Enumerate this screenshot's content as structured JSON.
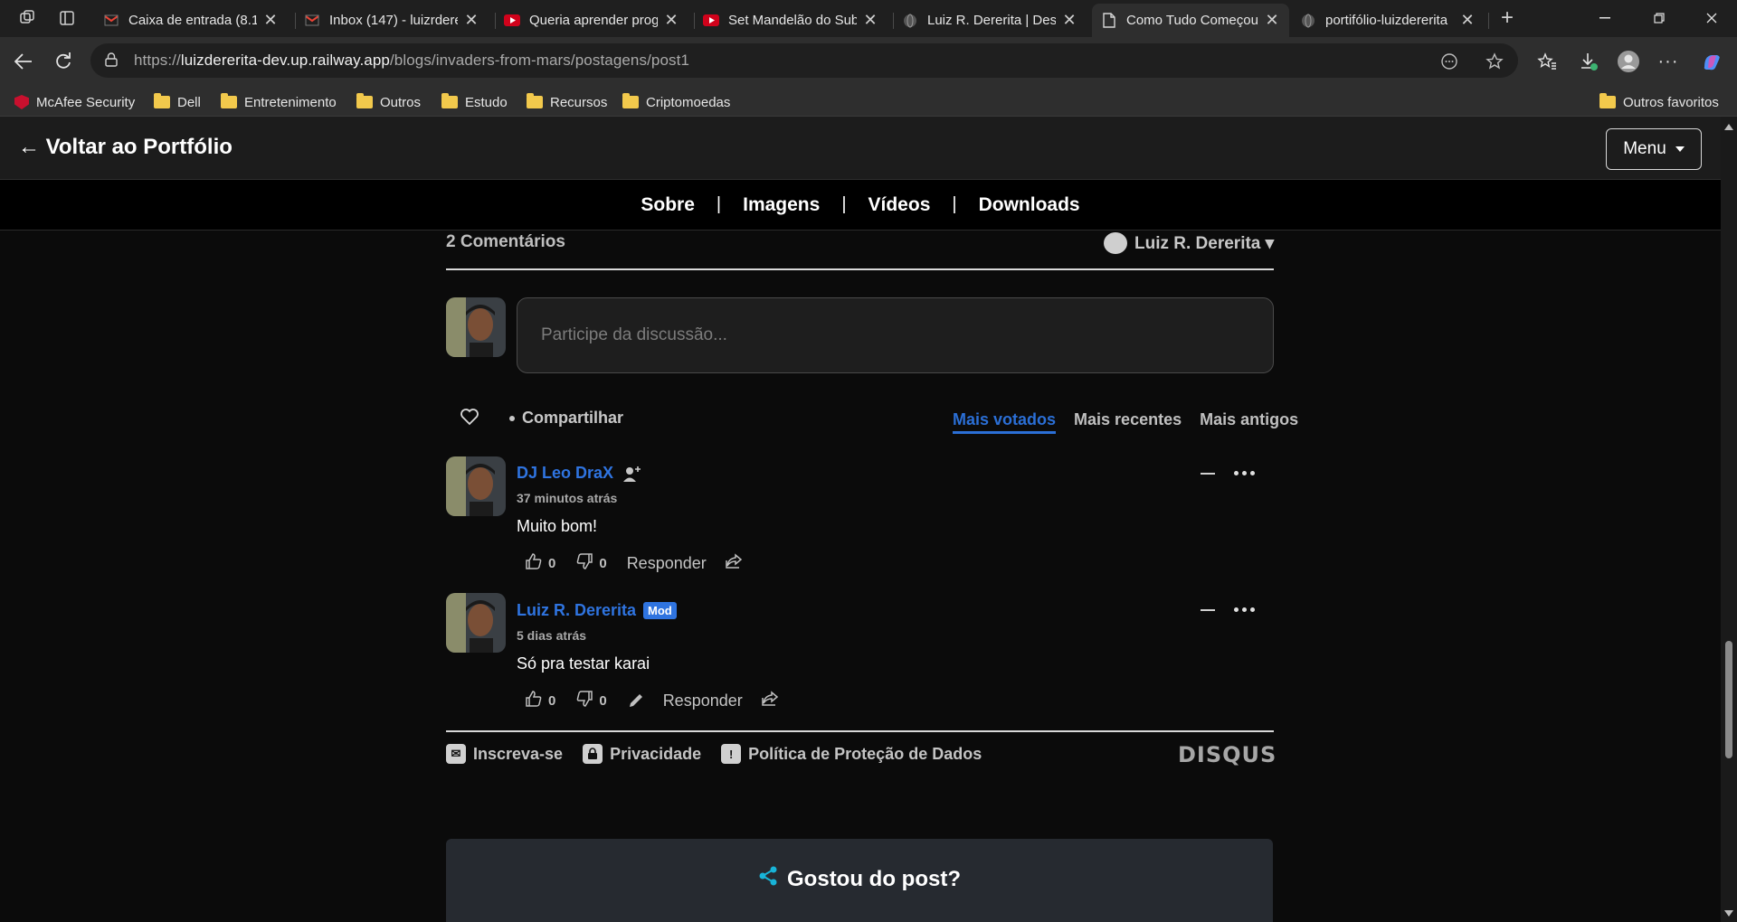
{
  "browser": {
    "tabs": [
      {
        "title": "Caixa de entrada (8.1",
        "icon": "gmail-icon"
      },
      {
        "title": "Inbox (147) - luizrdere",
        "icon": "gmail-icon"
      },
      {
        "title": "Queria aprender prog",
        "icon": "youtube-icon"
      },
      {
        "title": "Set Mandelão do Sub",
        "icon": "youtube-icon"
      },
      {
        "title": "Luiz R. Dererita | Dese",
        "icon": "globe-icon"
      },
      {
        "title": "Como Tudo Começou",
        "icon": "document-icon",
        "active": true
      },
      {
        "title": "portifólio-luizdererita",
        "icon": "globe-icon"
      }
    ],
    "address": {
      "scheme": "https://",
      "host": "luizdererita-dev.up.railway.app",
      "path": "/blogs/invaders-from-mars/postagens/post1"
    },
    "bookmarks": [
      {
        "label": "McAfee Security",
        "icon": "mcafee-icon"
      },
      {
        "label": "Dell",
        "icon": "folder-icon"
      },
      {
        "label": "Entretenimento",
        "icon": "folder-icon"
      },
      {
        "label": "Outros",
        "icon": "folder-icon"
      },
      {
        "label": "Estudo",
        "icon": "folder-icon"
      },
      {
        "label": "Recursos",
        "icon": "folder-icon"
      },
      {
        "label": "Criptomoedas",
        "icon": "folder-icon"
      }
    ],
    "other_favorites": "Outros favoritos"
  },
  "site": {
    "back_link": "← Voltar ao Portfólio",
    "menu_label": "Menu",
    "nav": [
      "Sobre",
      "Imagens",
      "Vídeos",
      "Downloads"
    ],
    "nav_separator": "|"
  },
  "comments": {
    "count_label": "2 Comentários",
    "logged_user": "Luiz R. Dererita ▾",
    "input_placeholder": "Participe da discussão...",
    "share_label": "Compartilhar",
    "sort": {
      "top": "Mais votados",
      "newest": "Mais recentes",
      "oldest": "Mais antigos",
      "selected": "top"
    },
    "items": [
      {
        "author": "DJ Leo DraX",
        "time": "37 minutos atrás",
        "body": "Muito bom!",
        "upvotes": "0",
        "downvotes": "0",
        "reply": "Responder",
        "badge": ""
      },
      {
        "author": "Luiz R. Dererita",
        "time": "5 dias atrás",
        "body": "Só pra testar karai",
        "upvotes": "0",
        "downvotes": "0",
        "reply": "Responder",
        "badge": "Mod"
      }
    ],
    "footer": {
      "subscribe": "Inscreva-se",
      "privacy": "Privacidade",
      "data_policy": "Política de Proteção de Dados",
      "brand": "DISQUS"
    }
  },
  "liked_card": {
    "title": "Gostou do post?"
  },
  "colors": {
    "accent": "#2f74e0",
    "page_bg": "#0b0b0b",
    "share_icon": "#18b4d8"
  }
}
